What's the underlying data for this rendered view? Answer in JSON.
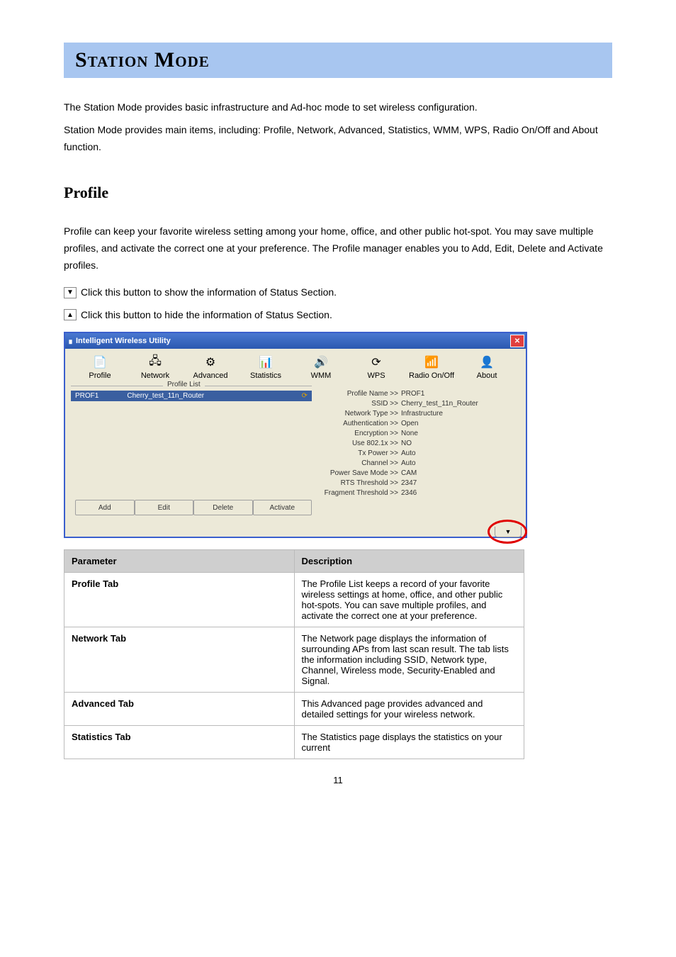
{
  "page": {
    "title": "Station Mode",
    "intro": [
      "The Station Mode provides basic infrastructure and Ad-hoc mode to set wireless configuration.",
      "Station Mode provides main items, including: Profile, Network, Advanced, Statistics, WMM, WPS, Radio On/Off and About function."
    ],
    "section_heading": "Profile",
    "profile_intro": [
      "Profile can keep your favorite wireless setting among your home, office, and other public hot-spot. You may save multiple profiles, and activate the correct one at your preference. The Profile manager enables you to Add, Edit, Delete and Activate profiles.",
      "Click this button to show the information of Status Section.",
      "Click this button to hide the information of Status Section."
    ],
    "down_glyph": "▼",
    "up_glyph": "▲"
  },
  "app": {
    "window_title": "Intelligent Wireless Utility",
    "toolbar": [
      "Profile",
      "Network",
      "Advanced",
      "Statistics",
      "WMM",
      "WPS",
      "Radio On/Off",
      "About"
    ],
    "toolbar_icons": [
      "📄",
      "🖧",
      "⚙",
      "📊",
      "🔊",
      "⟳",
      "📶",
      "👤"
    ],
    "profile_list_label": "Profile List",
    "profile_row": {
      "name": "PROF1",
      "ssid": "Cherry_test_11n_Router"
    },
    "details": [
      {
        "k": "Profile Name >>",
        "v": "PROF1"
      },
      {
        "k": "SSID >>",
        "v": "Cherry_test_11n_Router"
      },
      {
        "k": "Network Type >>",
        "v": "Infrastructure"
      },
      {
        "k": "Authentication >>",
        "v": "Open"
      },
      {
        "k": "Encryption >>",
        "v": "None"
      },
      {
        "k": "Use 802.1x >>",
        "v": "NO"
      },
      {
        "k": "Tx Power >>",
        "v": "Auto"
      },
      {
        "k": "Channel >>",
        "v": "Auto"
      },
      {
        "k": "Power Save Mode >>",
        "v": "CAM"
      },
      {
        "k": "RTS Threshold >>",
        "v": "2347"
      },
      {
        "k": "Fragment Threshold >>",
        "v": "2346"
      }
    ],
    "buttons": [
      "Add",
      "Edit",
      "Delete",
      "Activate"
    ],
    "expand_glyph": "▼"
  },
  "table": {
    "header": [
      "Parameter",
      "Description"
    ],
    "rows": [
      [
        "Profile Tab",
        "The Profile List keeps a record of your favorite wireless settings at home, office, and other public hot-spots. You can save multiple profiles, and activate the correct one at your preference."
      ],
      [
        "Network Tab",
        "The Network page displays the information of surrounding APs from last scan result. The tab lists the information including SSID, Network type, Channel, Wireless mode, Security-Enabled and Signal."
      ],
      [
        "Advanced Tab",
        "This Advanced page provides advanced and detailed settings for your wireless network."
      ],
      [
        "Statistics Tab",
        "The Statistics page displays the statistics on your current"
      ]
    ]
  },
  "page_number": "11"
}
